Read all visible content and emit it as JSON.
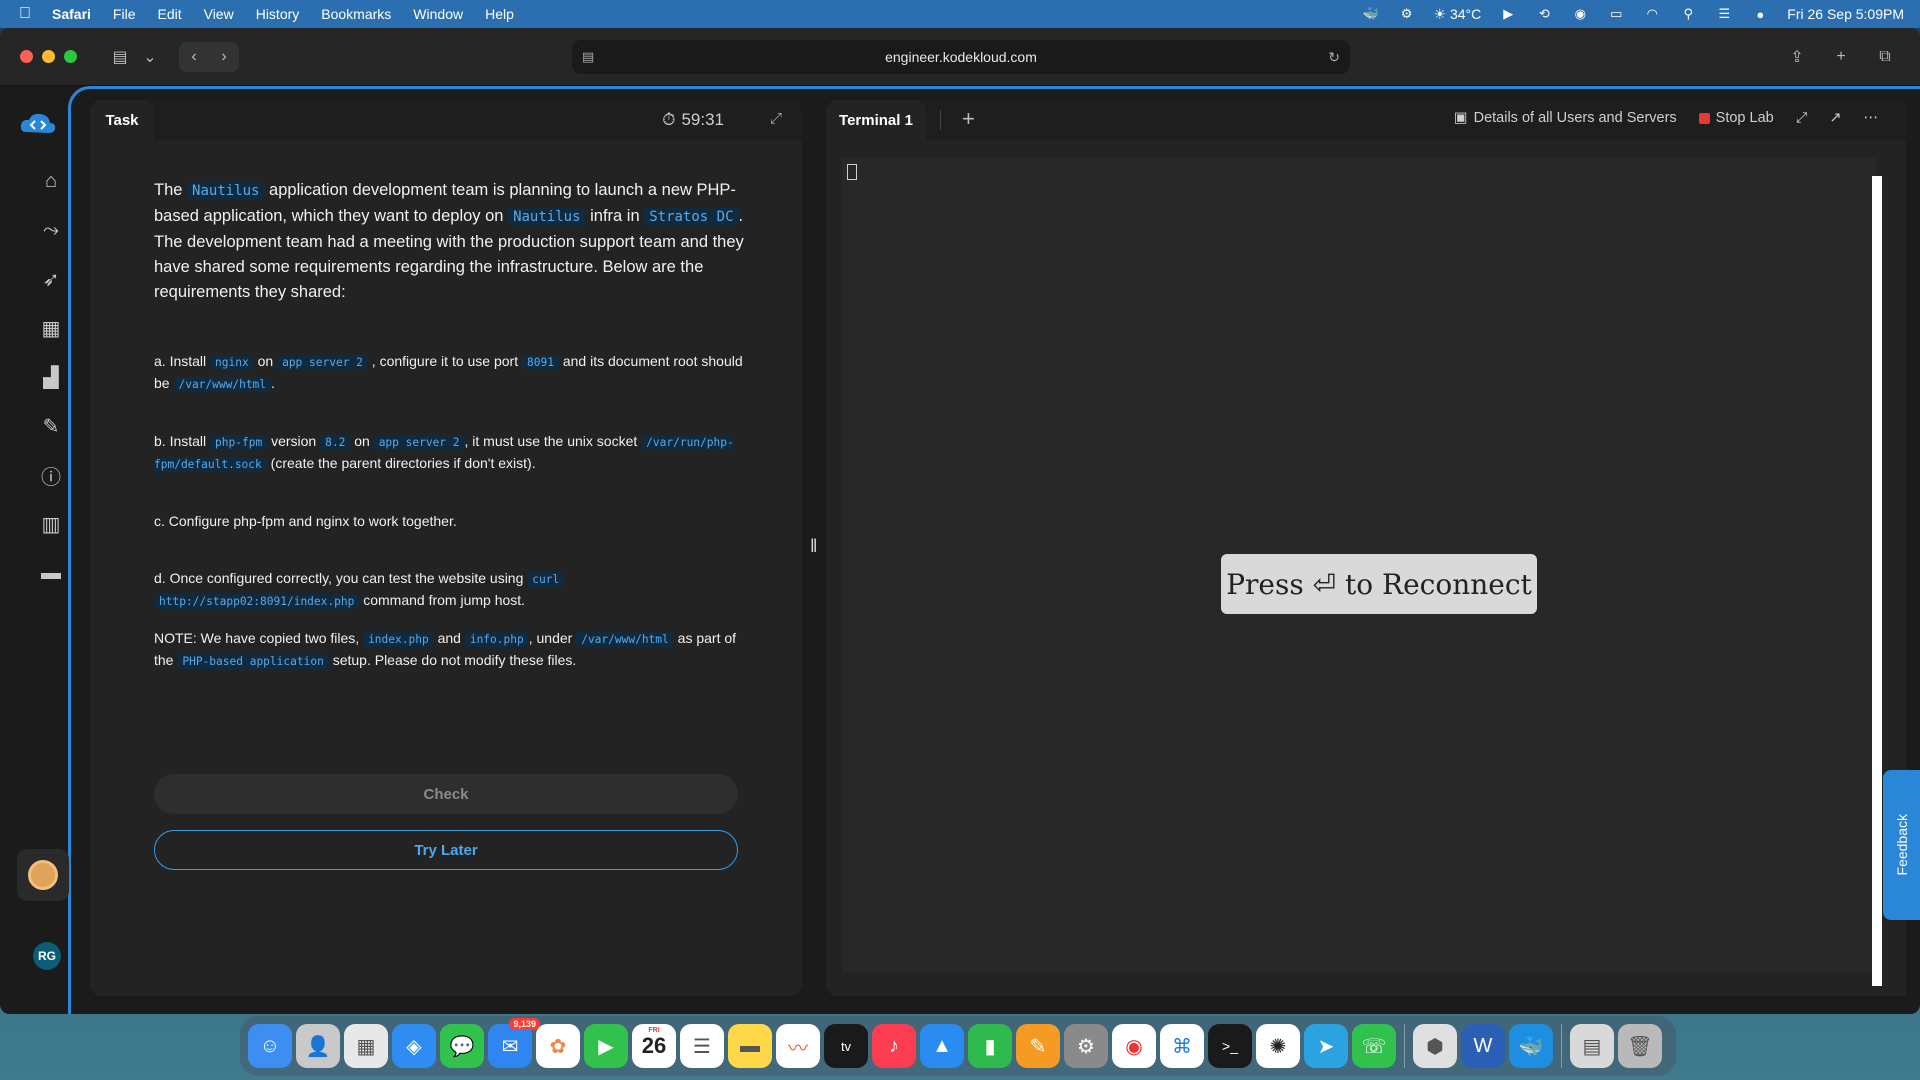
{
  "menubar": {
    "items": [
      "Safari",
      "File",
      "Edit",
      "View",
      "History",
      "Bookmarks",
      "Window",
      "Help"
    ],
    "weather": "34°C",
    "datetime": "Fri 26 Sep  5:09PM"
  },
  "browser": {
    "url": "engineer.kodekloud.com"
  },
  "task": {
    "tab_label": "Task",
    "timer": "59:31",
    "intro": {
      "p1": "The ",
      "c1": "Nautilus",
      "p2": " application development team is planning to launch a new PHP-based application, which they want to deploy on ",
      "c2": "Nautilus",
      "p3": " infra in ",
      "c3": "Stratos DC",
      "p4": ". The development team had a meeting with the production support team and they have shared some requirements regarding the infrastructure. Below are the requirements they shared:"
    },
    "req_a": {
      "p1": "a. Install ",
      "c1": "nginx",
      "p2": " on ",
      "c2": "app server 2",
      "p3": " , configure it to use port ",
      "c3": "8091",
      "p4": " and its document root should be ",
      "c4": "/var/www/html",
      "p5": "."
    },
    "req_b": {
      "p1": "b. Install ",
      "c1": "php-fpm",
      "p2": " version ",
      "c2": "8.2",
      "p3": " on ",
      "c3": "app server 2",
      "p4": ", it must use the unix socket ",
      "c4": "/var/run/php-fpm/default.sock",
      "p5": " (create the parent directories if don't exist)."
    },
    "req_c": "c. Configure php-fpm and nginx to work together.",
    "req_d": {
      "p1": "d. Once configured correctly, you can test the website using ",
      "c1": "curl",
      "c2": "http://stapp02:8091/index.php",
      "p2": " command from jump host."
    },
    "note": {
      "p1": "NOTE: We have copied two files, ",
      "c1": "index.php",
      "p2": " and ",
      "c2": "info.php",
      "p3": ", under ",
      "c3": "/var/www/html",
      "p4": " as part of the ",
      "c4": "PHP-based application",
      "p5": " setup. Please do not modify these files."
    },
    "check_label": "Check",
    "try_later_label": "Try Later"
  },
  "terminal": {
    "tab_label": "Terminal 1",
    "details_label": "Details of all Users and Servers",
    "stop_label": "Stop Lab",
    "reconnect_label": "Press ⏎ to Reconnect"
  },
  "user": {
    "initials": "RG"
  },
  "feedback": {
    "label": "Feedback"
  },
  "dock": {
    "mail_badge": "9,139",
    "calendar_day": "FRI",
    "calendar_date": "26",
    "tv_label": "tv"
  },
  "colors": {
    "accent": "#2a86d6",
    "code_text": "#5aa9e6",
    "stop": "#e53935"
  }
}
